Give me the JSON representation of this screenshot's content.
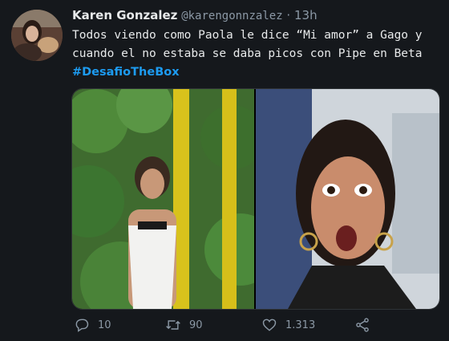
{
  "tweet": {
    "author_name": "Karen Gonzalez",
    "handle": "@karengonnzalez",
    "separator": "·",
    "time": "13h",
    "text_line1": "Todos viendo como Paola le dice “Mi amor” a Gago y",
    "text_line2": "cuando el no estaba se daba picos con Pipe en Beta",
    "hashtag": "#DesafioTheBox",
    "replies": "10",
    "retweets": "90",
    "likes": "1.313"
  },
  "icons": {
    "reply": "reply-icon",
    "retweet": "retweet-icon",
    "like": "heart-icon",
    "share": "share-icon"
  },
  "colors": {
    "background": "#15181c",
    "text": "#e7e9ea",
    "muted": "#8b98a5",
    "link": "#1d9bf0"
  }
}
